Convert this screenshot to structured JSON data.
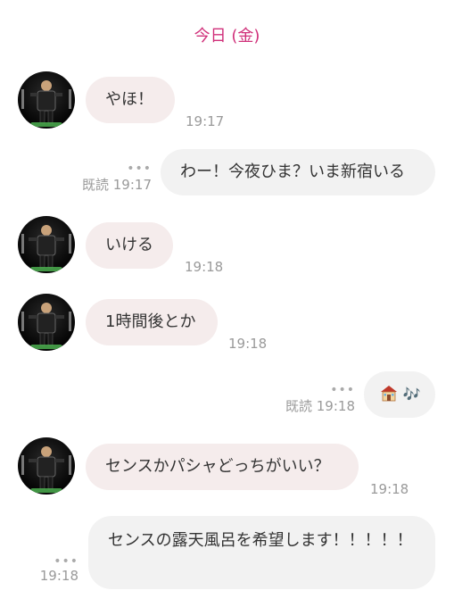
{
  "date_header": "今日 (金)",
  "messages": [
    {
      "side": "in",
      "text": "やほ！",
      "time": "19:17"
    },
    {
      "side": "out",
      "text": "わー！今夜ひま？いま新宿いる",
      "read": "既読",
      "time": "19:17",
      "dots": "•••"
    },
    {
      "side": "in",
      "text": "いける",
      "time": "19:18"
    },
    {
      "side": "in",
      "text": "1時間後とか",
      "time": "19:18"
    },
    {
      "side": "out",
      "emoji_notes": "🎶",
      "read": "既読",
      "time": "19:18",
      "dots": "•••"
    },
    {
      "side": "in",
      "text": "センスかパシャどっちがいい？",
      "time": "19:18"
    },
    {
      "side": "out",
      "text": "センスの露天風呂を希望します！！！！！",
      "time": "19:18",
      "dots": "•••"
    }
  ],
  "icons": {
    "avatar": "avatar-figure-icon",
    "more": "more-dots-icon",
    "house": "house-icon"
  },
  "colors": {
    "date_header": "#d0307a",
    "incoming_bubble": "#f5ecec",
    "outgoing_bubble": "#f2f2f2",
    "meta_text": "#9a9a9a"
  }
}
